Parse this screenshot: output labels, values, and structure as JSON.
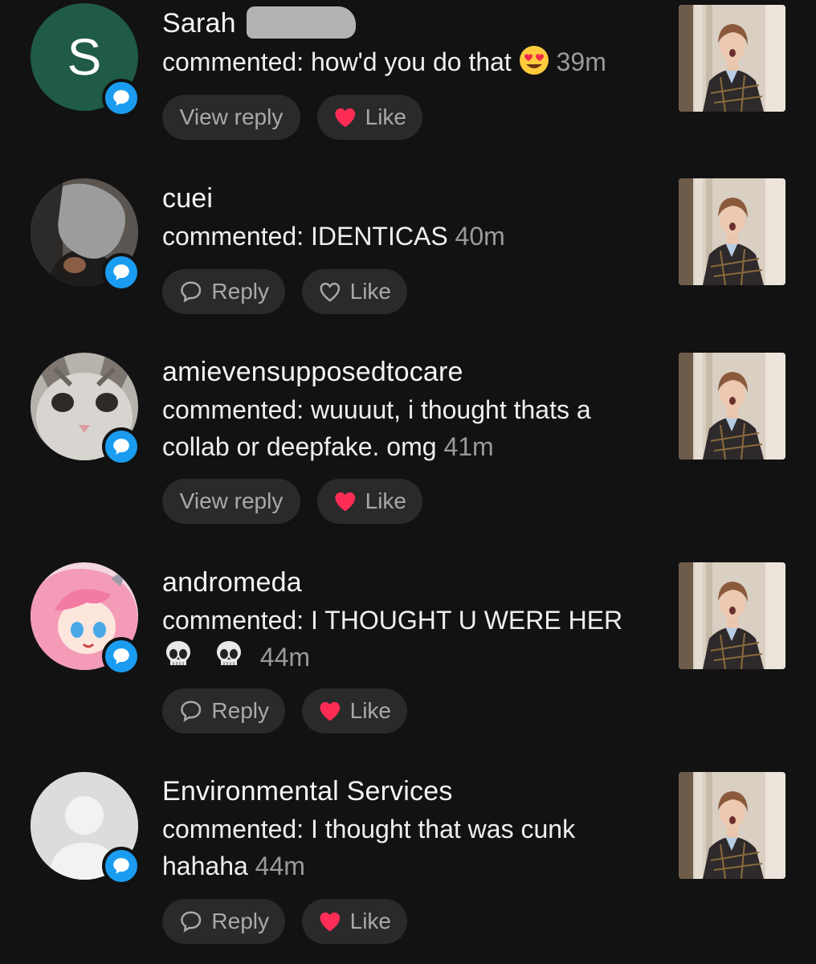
{
  "colors": {
    "background": "#121212",
    "badge": "#1a9cf0",
    "button_bg": "#2a2a2a",
    "heart_active": "#ff2d55",
    "muted_text": "#9a9a9a"
  },
  "comments": [
    {
      "username": "Sarah",
      "prefix": "commented: how'd you do that",
      "emoji": "heart-eyes-icon",
      "text_after_emoji": "",
      "time": "39m",
      "avatar_letter": "S",
      "reply_button": "View reply",
      "like_button": "Like",
      "liked": true
    },
    {
      "username": "cuei",
      "prefix": "commented: IDENTICAS",
      "time": "40m",
      "reply_button": "Reply",
      "like_button": "Like",
      "liked": false
    },
    {
      "username": "amievensupposedtocare",
      "prefix": "commented: wuuuut, i thought thats a collab or deepfake. omg",
      "time": "41m",
      "reply_button": "View reply",
      "like_button": "Like",
      "liked": true
    },
    {
      "username": "andromeda",
      "prefix": "commented: I THOUGHT U WERE HER",
      "emoji": "skull-icon",
      "time": "44m",
      "reply_button": "Reply",
      "like_button": "Like",
      "liked": true
    },
    {
      "username": "Environmental Services",
      "prefix": "commented: I thought that was cunk hahaha",
      "time": "44m",
      "reply_button": "Reply",
      "like_button": "Like",
      "liked": true
    }
  ]
}
